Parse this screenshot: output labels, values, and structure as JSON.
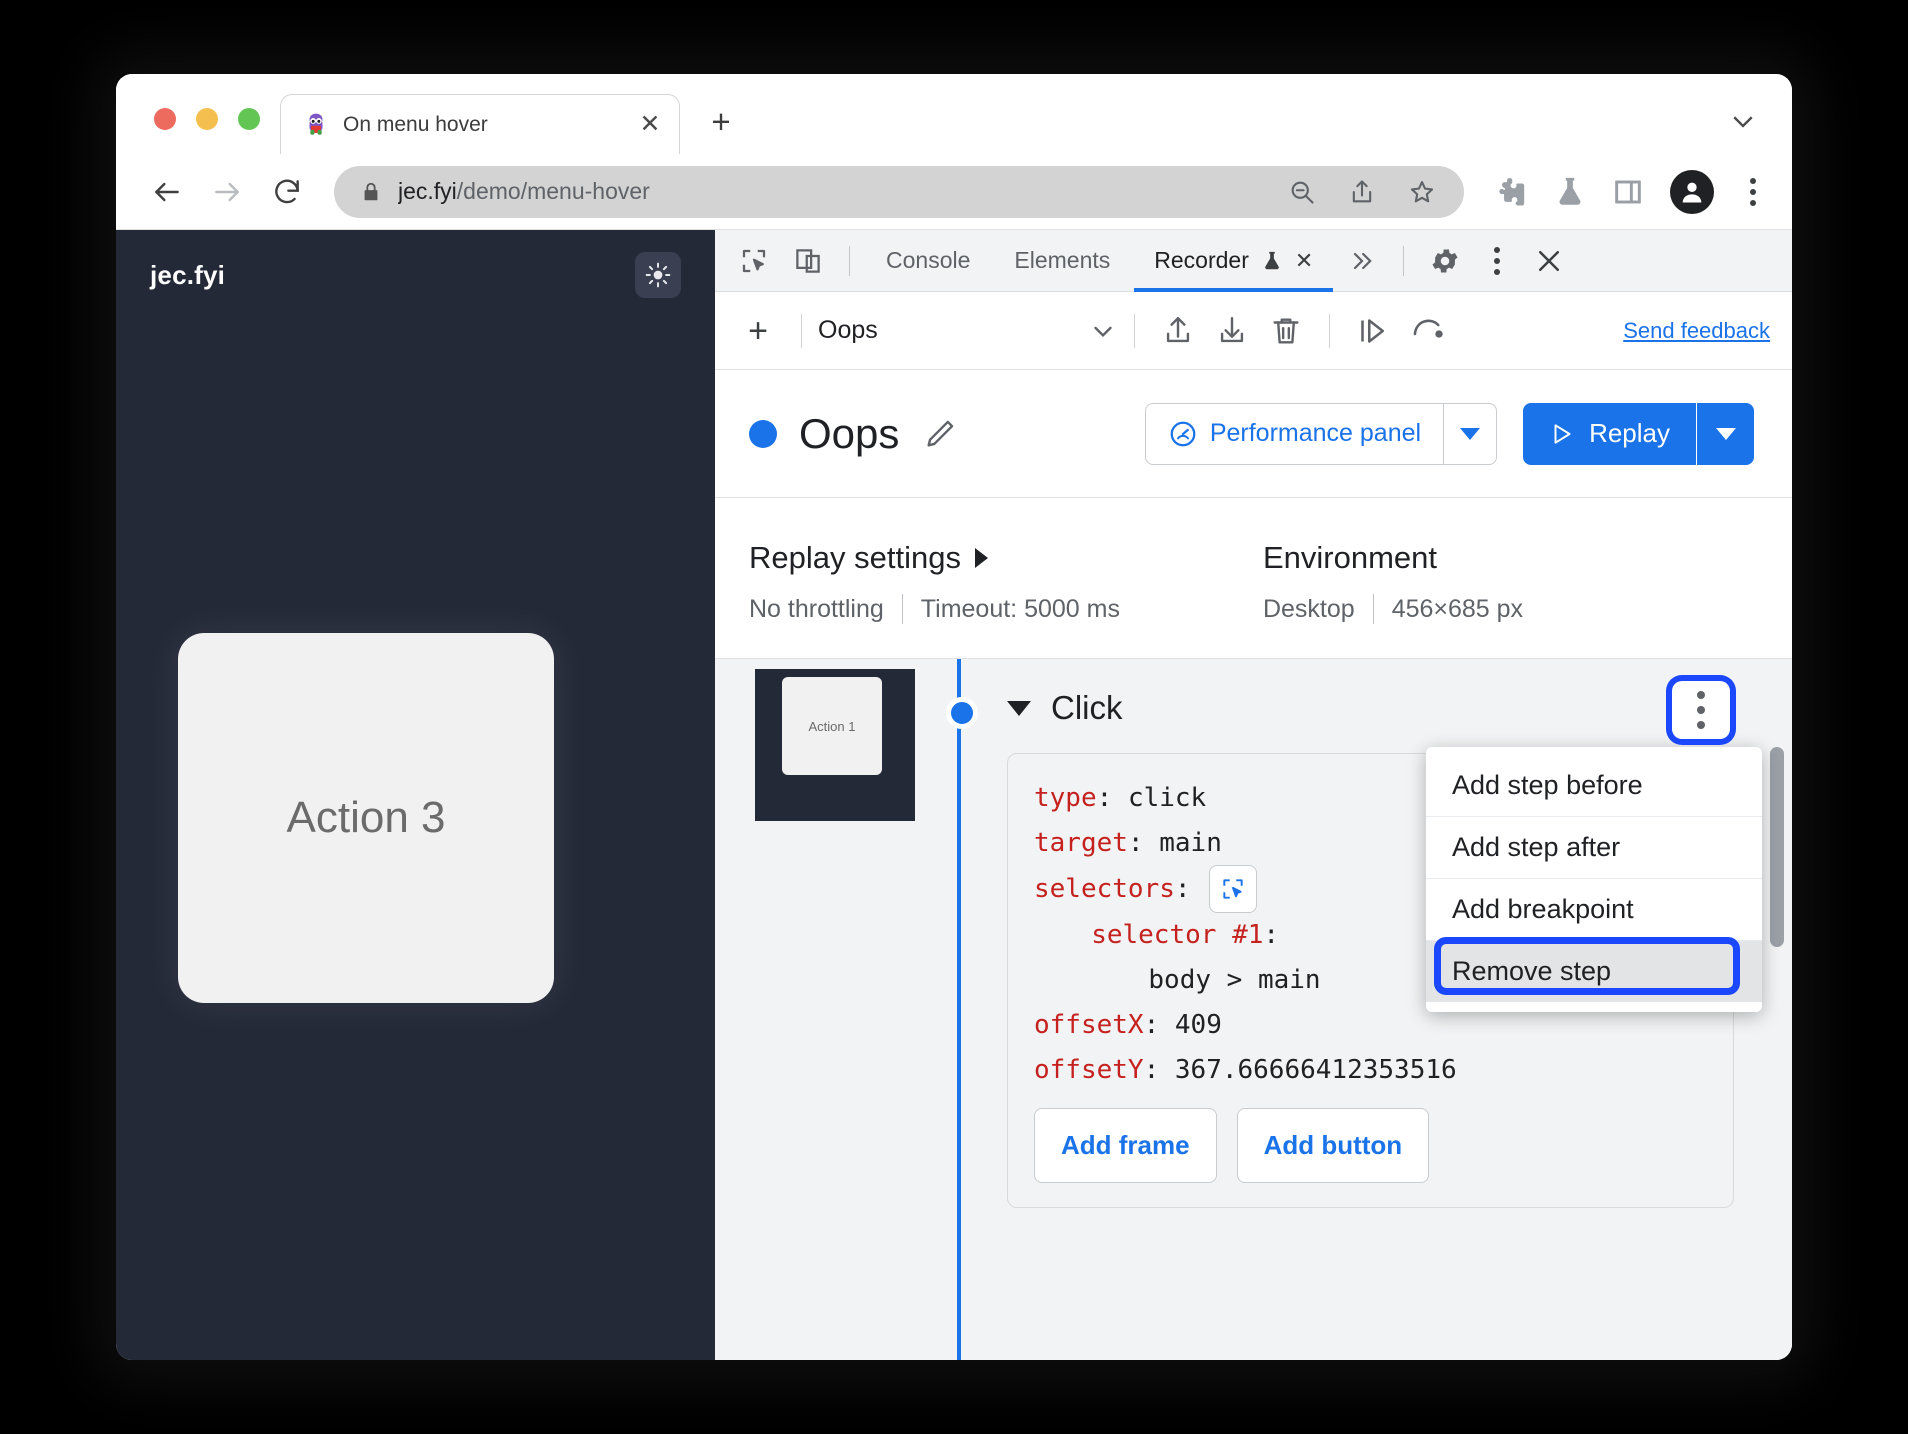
{
  "browser": {
    "tab": {
      "title": "On menu hover",
      "favicon": "puppeteer-icon",
      "close_label": "✕"
    },
    "new_tab_label": "+",
    "toolbar": {
      "back_icon": "back-arrow-icon",
      "forward_icon": "forward-arrow-icon",
      "reload_icon": "reload-icon",
      "lock_icon": "lock-icon",
      "url_host": "jec.fyi",
      "url_path": "/demo/menu-hover",
      "zoom_out_icon": "zoom-out-icon",
      "share_icon": "share-icon",
      "bookmark_icon": "star-icon",
      "extensions_icon": "puzzle-piece-icon",
      "experiments_icon": "flask-icon",
      "side_panel_icon": "side-panel-icon",
      "profile_icon": "person-avatar-icon",
      "menu_icon": "three-dot-menu-icon"
    }
  },
  "page": {
    "brand": "jec.fyi",
    "theme_toggle_icon": "sun-icon",
    "card_label": "Action 3"
  },
  "devtools": {
    "inspect_icon": "inspect-element-icon",
    "device_icon": "device-toolbar-icon",
    "tabs": [
      {
        "label": "Console",
        "active": false
      },
      {
        "label": "Elements",
        "active": false
      },
      {
        "label": "Recorder",
        "active": true,
        "experimental": true,
        "closable": true
      }
    ],
    "more_tabs_icon": "chevron-double-right-icon",
    "settings_icon": "gear-icon",
    "more_icon": "three-dot-menu-icon",
    "close_icon": "close-icon"
  },
  "recorder": {
    "toolbar": {
      "add_icon": "plus-icon",
      "recording_name": "Oops",
      "dropdown_icon": "chevron-down-icon",
      "export_icon": "export-upload-icon",
      "import_icon": "import-download-icon",
      "delete_icon": "trash-icon",
      "step_over_icon": "step-over-icon",
      "undo_icon": "undo-icon",
      "send_feedback": "Send feedback"
    },
    "header": {
      "status_dot_color": "#1a73e8",
      "title": "Oops",
      "edit_icon": "pencil-icon",
      "performance_panel_label": "Performance panel",
      "performance_panel_icon": "performance-gauge-icon",
      "performance_caret_icon": "caret-down-icon",
      "replay_label": "Replay",
      "replay_icon": "play-triangle-icon",
      "replay_caret_icon": "caret-down-icon"
    },
    "settings": {
      "replay_settings_title": "Replay settings",
      "replay_settings_caret": "caret-right-icon",
      "throttling": "No throttling",
      "timeout": "Timeout: 5000 ms",
      "environment_title": "Environment",
      "device": "Desktop",
      "viewport": "456×685 px"
    },
    "step": {
      "thumbnail_label": "Action 1",
      "collapse_icon": "caret-down-icon",
      "title": "Click",
      "code": [
        {
          "key": "type",
          "value": "click",
          "indent": 0
        },
        {
          "key": "target",
          "value": "main",
          "indent": 0
        },
        {
          "key": "selectors",
          "value": "",
          "indent": 0,
          "picker_icon": "selector-picker-icon"
        },
        {
          "key": "selector #1",
          "value": "",
          "indent": 1
        },
        {
          "key": "",
          "value": "body > main",
          "indent": 2
        },
        {
          "key": "offsetX",
          "value": "409",
          "indent": 0
        },
        {
          "key": "offsetY",
          "value": "367.66666412353516",
          "indent": 0
        }
      ],
      "add_frame_label": "Add frame",
      "add_button_label": "Add button",
      "kebab_icon": "three-dot-menu-icon"
    },
    "context_menu": {
      "items": [
        {
          "label": "Add step before",
          "highlighted": false
        },
        {
          "label": "Add step after",
          "highlighted": false
        },
        {
          "label": "Add breakpoint",
          "highlighted": false
        },
        {
          "label": "Remove step",
          "highlighted": true
        }
      ]
    }
  },
  "colors": {
    "accent_blue": "#1a73e8",
    "highlight_ring": "#1b47ff",
    "code_key_red": "#c5221f",
    "page_dark": "#242938"
  }
}
